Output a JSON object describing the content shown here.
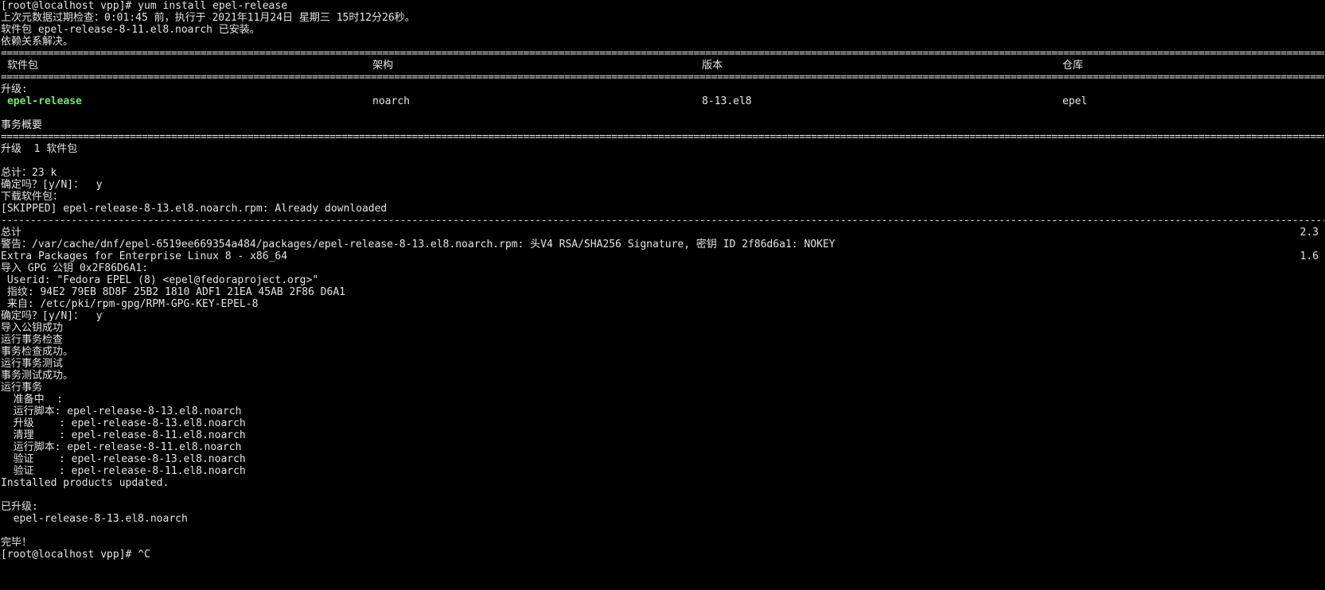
{
  "colors": {
    "background": "#000000",
    "text": "#e4e4e4",
    "package_highlight": "#6ee96e"
  },
  "lines": {
    "command": "[root@localhost vpp]# yum install epel-release",
    "metadata_check": "上次元数据过期检查：0:01:45 前，执行于 2021年11月24日 星期三 15时12分26秒。",
    "already_installed": "软件包 epel-release-8-11.el8.noarch 已安装。",
    "deps_resolved": "依赖关系解决。",
    "upgrade_heading": "升级:",
    "summary_heading": "事务概要",
    "upgrade_count": "升级  1 软件包",
    "total_size": "总计：23 k",
    "confirm_1": "确定吗？[y/N]：  y",
    "downloading": "下载软件包：",
    "skipped": "[SKIPPED] epel-release-8-13.el8.noarch.rpm: Already downloaded",
    "total_label": "总计",
    "total_rate": "2.3",
    "warning": "警告：/var/cache/dnf/epel-6519ee669354a484/packages/epel-release-8-13.el8.noarch.rpm: 头V4 RSA/SHA256 Signature, 密钥 ID 2f86d6a1: NOKEY",
    "repo_name": "Extra Packages for Enterprise Linux 8 - x86_64",
    "repo_rate": "1.6",
    "import_gpg": "导入 GPG 公钥 0x2F86D6A1:",
    "userid": " Userid: \"Fedora EPEL (8) <epel@fedoraproject.org>\"",
    "fingerprint": " 指纹: 94E2 79EB 8D8F 25B2 1810 ADF1 21EA 45AB 2F86 D6A1",
    "from": " 来自: /etc/pki/rpm-gpg/RPM-GPG-KEY-EPEL-8",
    "confirm_2": "确定吗？[y/N]：  y",
    "import_ok": "导入公钥成功",
    "run_check": "运行事务检查",
    "check_ok": "事务检查成功。",
    "run_test": "运行事务测试",
    "test_ok": "事务测试成功。",
    "run_tx": "运行事务",
    "step_prepare": "  准备中  :",
    "step_script_1": "  运行脚本: epel-release-8-13.el8.noarch",
    "step_upgrade": "  升级    : epel-release-8-13.el8.noarch",
    "step_cleanup": "  清理    : epel-release-8-11.el8.noarch",
    "step_script_2": "  运行脚本: epel-release-8-11.el8.noarch",
    "step_verify_1": "  验证    : epel-release-8-13.el8.noarch",
    "step_verify_2": "  验证    : epel-release-8-11.el8.noarch",
    "products_updated": "Installed products updated.",
    "upgraded_heading": "已升级:",
    "upgraded_pkg": "  epel-release-8-13.el8.noarch",
    "done": "完毕！",
    "next_prompt": "[root@localhost vpp]# ^C"
  },
  "table": {
    "headers": {
      "package": "软件包",
      "arch": "架构",
      "version": "版本",
      "repo": "仓库"
    },
    "row": {
      "package": "epel-release",
      "arch": "noarch",
      "version": "8-13.el8",
      "repo": "epel"
    }
  }
}
